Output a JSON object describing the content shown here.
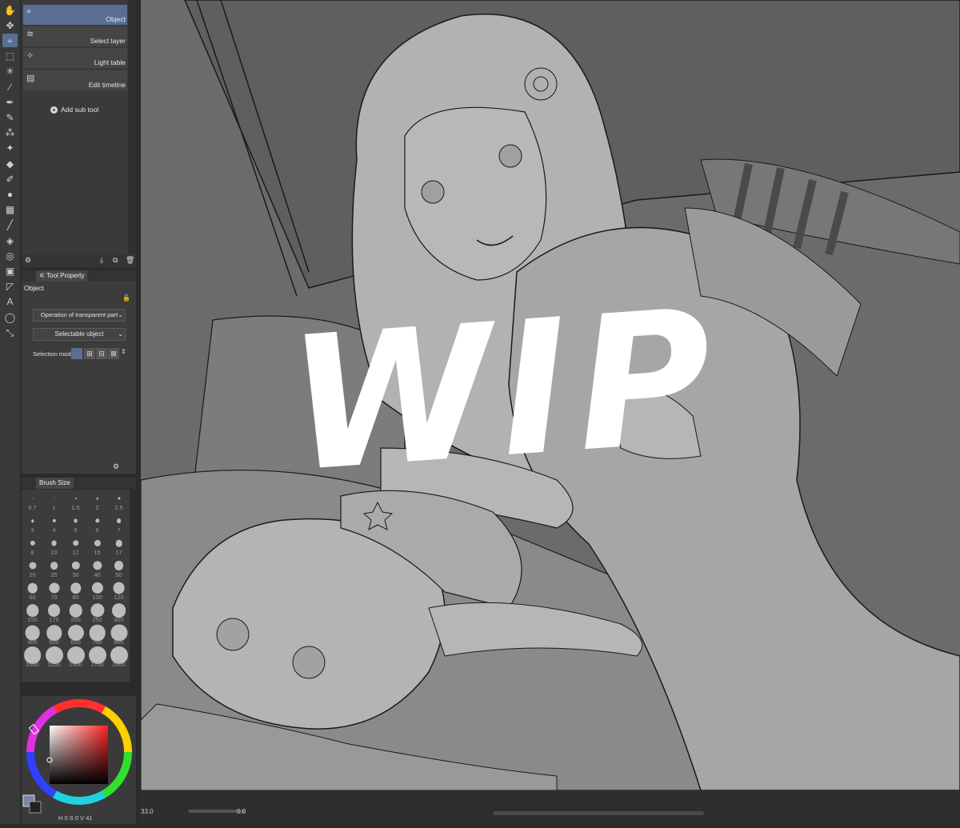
{
  "tools": [
    {
      "name": "hand-tool-icon",
      "glyph": "✋"
    },
    {
      "name": "move-tool-icon",
      "glyph": "✥"
    },
    {
      "name": "operation-tool-icon",
      "glyph": "⌖",
      "active": true
    },
    {
      "name": "selection-tool-icon",
      "glyph": "⬚"
    },
    {
      "name": "auto-select-tool-icon",
      "glyph": "✳"
    },
    {
      "name": "eyedropper-tool-icon",
      "glyph": "⁄"
    },
    {
      "name": "pen-tool-icon",
      "glyph": "✒"
    },
    {
      "name": "pencil-tool-icon",
      "glyph": "✎"
    },
    {
      "name": "airbrush-tool-icon",
      "glyph": "⁂"
    },
    {
      "name": "decoration-tool-icon",
      "glyph": "✦"
    },
    {
      "name": "eraser-tool-icon",
      "glyph": "◆"
    },
    {
      "name": "blend-tool-icon",
      "glyph": "✐"
    },
    {
      "name": "fill-drop-tool-icon",
      "glyph": "●"
    },
    {
      "name": "figure-tool-icon",
      "glyph": "▦"
    },
    {
      "name": "line-tool-icon",
      "glyph": "╱"
    },
    {
      "name": "fill-tool-icon",
      "glyph": "◈"
    },
    {
      "name": "gradient-tool-icon",
      "glyph": "◎"
    },
    {
      "name": "frame-tool-icon",
      "glyph": "▣"
    },
    {
      "name": "ruler-tool-icon",
      "glyph": "◸"
    },
    {
      "name": "text-tool-icon",
      "glyph": "A"
    },
    {
      "name": "balloon-tool-icon",
      "glyph": "◯"
    },
    {
      "name": "correct-line-tool-icon",
      "glyph": "⤡"
    }
  ],
  "subtools": [
    {
      "label": "Object",
      "selected": true
    },
    {
      "label": "Select layer",
      "selected": false
    },
    {
      "label": "Light table",
      "selected": false
    },
    {
      "label": "Edit timeline",
      "selected": false
    }
  ],
  "add_sub_tool": "Add sub tool",
  "tool_property": {
    "tab": "Tool Property",
    "title": "Object",
    "operation_dropdown": "Operation of transparent part",
    "selectable_dropdown": "Selectable object",
    "selection_mode_label": "Selection mode"
  },
  "brush_size": {
    "tab": "Brush Size",
    "sizes": [
      "0.7",
      "1",
      "1.5",
      "2",
      "2.5",
      "3",
      "4",
      "5",
      "6",
      "7",
      "8",
      "10",
      "12",
      "15",
      "17",
      "20",
      "25",
      "30",
      "40",
      "50",
      "60",
      "70",
      "80",
      "100",
      "120",
      "150",
      "170",
      "200",
      "250",
      "300",
      "400",
      "500",
      "600",
      "700",
      "800",
      "1000",
      "1200",
      "1500",
      "1700",
      "2000"
    ]
  },
  "color_readout": {
    "h": "0",
    "s": "0",
    "v": "41"
  },
  "status": {
    "zoom": "33.0",
    "angle": "0.0"
  },
  "canvas_overlay_text": "WIP",
  "colors": {
    "accent": "#5a6e94",
    "canvas_bg": "#6a6a6a",
    "line_art": "#1a1a1a",
    "fill_light": "#b4b4b4"
  }
}
